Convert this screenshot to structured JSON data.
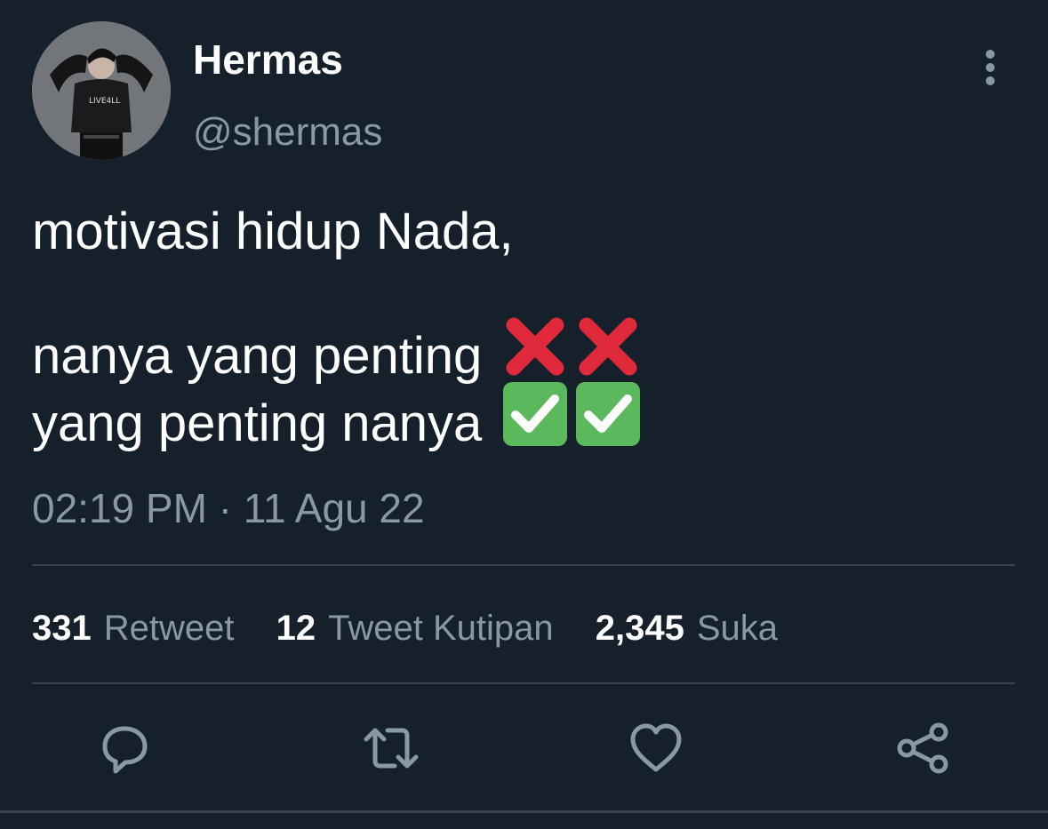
{
  "author": {
    "display_name": "Hermas",
    "handle": "@shermas",
    "avatar_shirt_text": "LIVE4LL"
  },
  "tweet": {
    "line1": "motivasi hidup Nada,",
    "line2": "nanya yang penting",
    "line3": "yang penting nanya",
    "line2_emojis": [
      "cross-mark",
      "cross-mark"
    ],
    "line3_emojis": [
      "check-mark-button",
      "check-mark-button"
    ]
  },
  "timestamp": "02:19 PM · 11 Agu 22",
  "stats": {
    "retweets_count": "331",
    "retweets_label": "Retweet",
    "quotes_count": "12",
    "quotes_label": "Tweet Kutipan",
    "likes_count": "2,345",
    "likes_label": "Suka"
  },
  "actions": [
    "reply-icon",
    "retweet-icon",
    "like-icon",
    "share-icon"
  ],
  "colors": {
    "background": "#15202b",
    "text_primary": "#ffffff",
    "text_secondary": "#8899a6",
    "divider": "#38444d",
    "cross": "#e0293a",
    "check": "#5cb85c"
  }
}
